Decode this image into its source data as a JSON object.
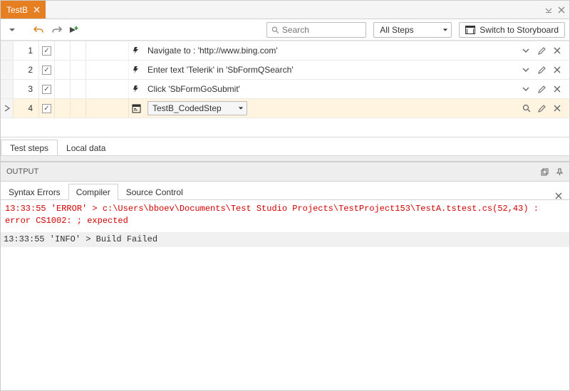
{
  "file_tab": {
    "name": "TestB"
  },
  "toolbar": {
    "search_placeholder": "Search",
    "filter_label": "All Steps",
    "storyboard_label": "Switch to Storyboard"
  },
  "steps": [
    {
      "n": "1",
      "desc": "Navigate to : 'http://www.bing.com'"
    },
    {
      "n": "2",
      "desc": "Enter text 'Telerik' in 'SbFormQSearch'"
    },
    {
      "n": "3",
      "desc": "Click 'SbFormGoSubmit'"
    }
  ],
  "coded_step": {
    "n": "4",
    "name": "TestB_CodedStep"
  },
  "mid_tabs": {
    "steps": "Test steps",
    "local": "Local data"
  },
  "output": {
    "title": "OUTPUT",
    "tabs": {
      "syntax": "Syntax Errors",
      "compiler": "Compiler",
      "source": "Source Control"
    },
    "error_line": "13:33:55 'ERROR' > c:\\Users\\bboev\\Documents\\Test Studio Projects\\TestProject153\\TestA.tstest.cs(52,43) : error CS1002: ; expected",
    "info_line": "13:33:55 'INFO' > Build Failed"
  }
}
